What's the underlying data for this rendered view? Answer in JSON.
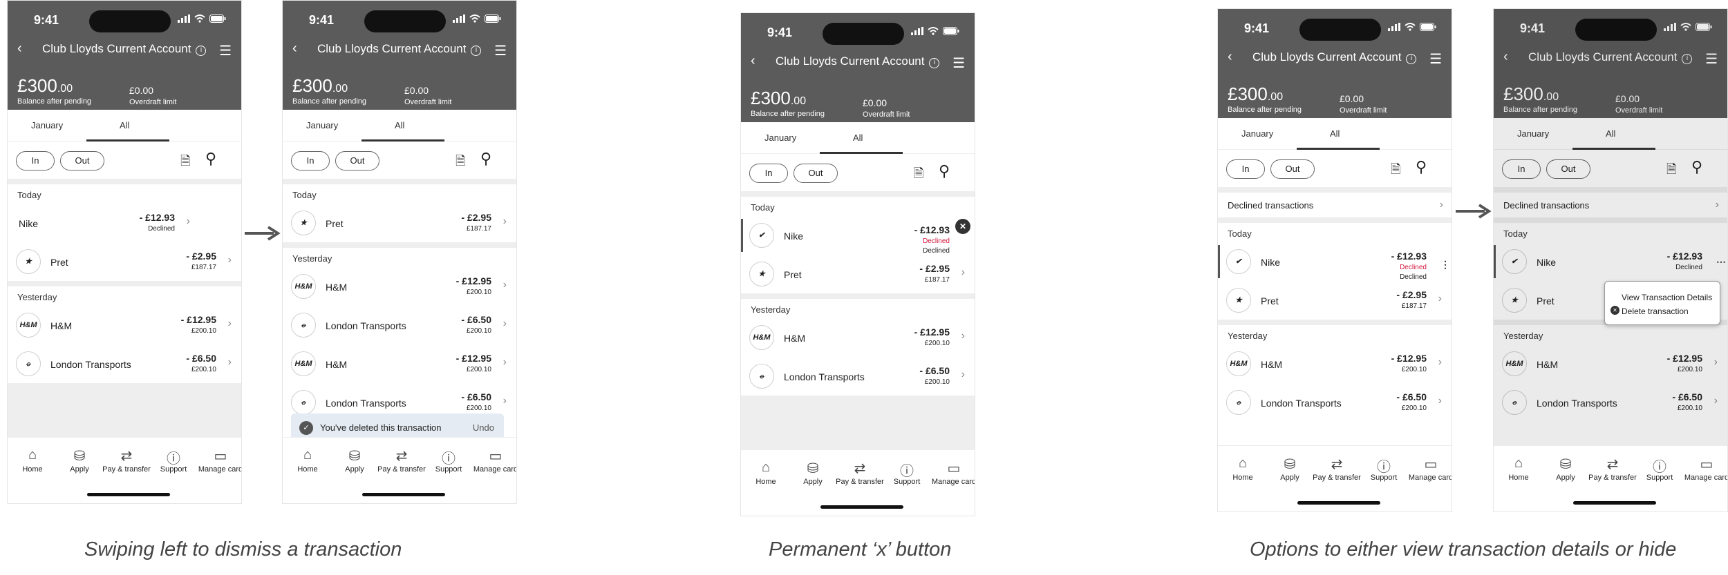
{
  "status_time": "9:41",
  "account": {
    "title": "Club Lloyds Current Account",
    "balance_main": "£300",
    "balance_pence": ".00",
    "balance_label": "Balance after pending",
    "overdraft": "£0.00",
    "overdraft_label": "Overdraft limit"
  },
  "tabs": {
    "january": "January",
    "all": "All"
  },
  "filters": {
    "in": "In",
    "out": "Out"
  },
  "sections": {
    "today": "Today",
    "yesterday": "Yesterday",
    "declined_transactions": "Declined transactions"
  },
  "transactions": {
    "nike": {
      "name": "Nike",
      "amount": "- £12.93",
      "status": "Declined",
      "status2": "Declined",
      "logo": "nike-swoosh"
    },
    "pret": {
      "name": "Pret",
      "amount": "- £2.95",
      "balance": "£187.17",
      "logo": "pret-star"
    },
    "hm": {
      "name": "H&M",
      "amount": "- £12.95",
      "balance": "£200.10",
      "logo_text": "H&M"
    },
    "london": {
      "name": "London Transports",
      "amount": "- £6.50",
      "balance": "£200.10",
      "logo": "roundel"
    }
  },
  "toast": {
    "message": "You've deleted this transaction",
    "undo": "Undo"
  },
  "popup": {
    "view": "View Transaction Details",
    "delete": "Delete transaction"
  },
  "nav": {
    "home": "Home",
    "apply": "Apply",
    "pay": "Pay & transfer",
    "support": "Support",
    "manage": "Manage card"
  },
  "captions": {
    "swipe": "Swiping left to dismiss a transaction",
    "permanent": "Permanent ‘x’ button",
    "options": "Options to either view transaction details or hide"
  },
  "colors": {
    "header": "#5b5b5b",
    "declined_red": "#d2153b",
    "swipe_red": "#e11a48",
    "toast_bg": "#e4ebf2"
  }
}
